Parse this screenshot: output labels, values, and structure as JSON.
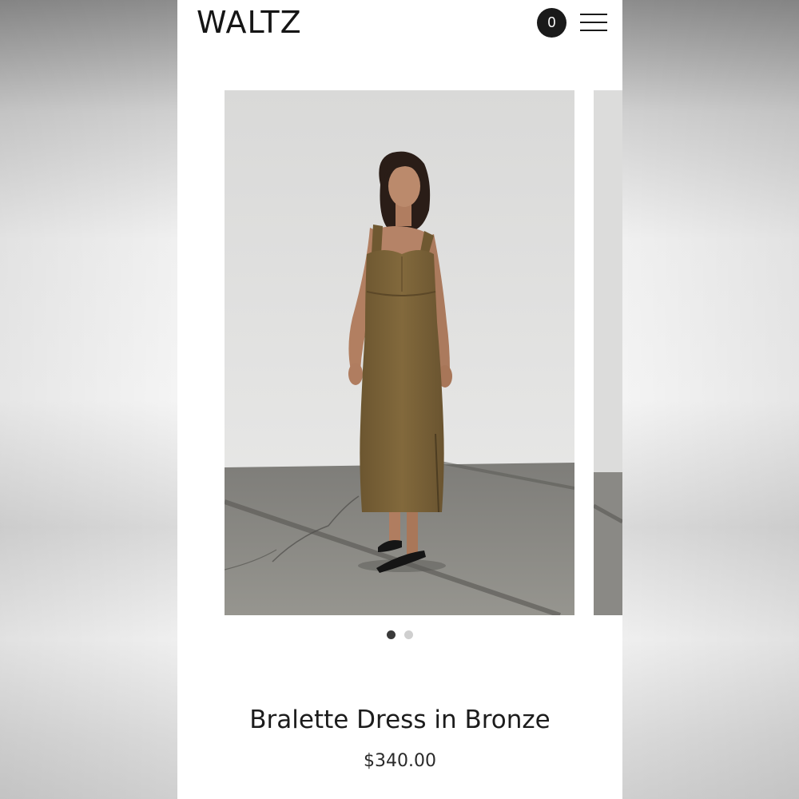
{
  "header": {
    "logo_text": "WALTZ",
    "cart_count": "0",
    "menu_icon": "hamburger-menu-icon"
  },
  "carousel": {
    "slides": [
      {
        "image": "model-in-bronze-dress-photo"
      },
      {
        "image": "next-product-photo-partial"
      }
    ],
    "active_index": 1,
    "total": 2
  },
  "product": {
    "name": "Bralette Dress in Bronze",
    "price": "$340.00"
  },
  "colors": {
    "dress": "#7a6236",
    "wall": "#e3e3e1",
    "floor": "#8c8c88",
    "text": "#1c1c1c"
  }
}
